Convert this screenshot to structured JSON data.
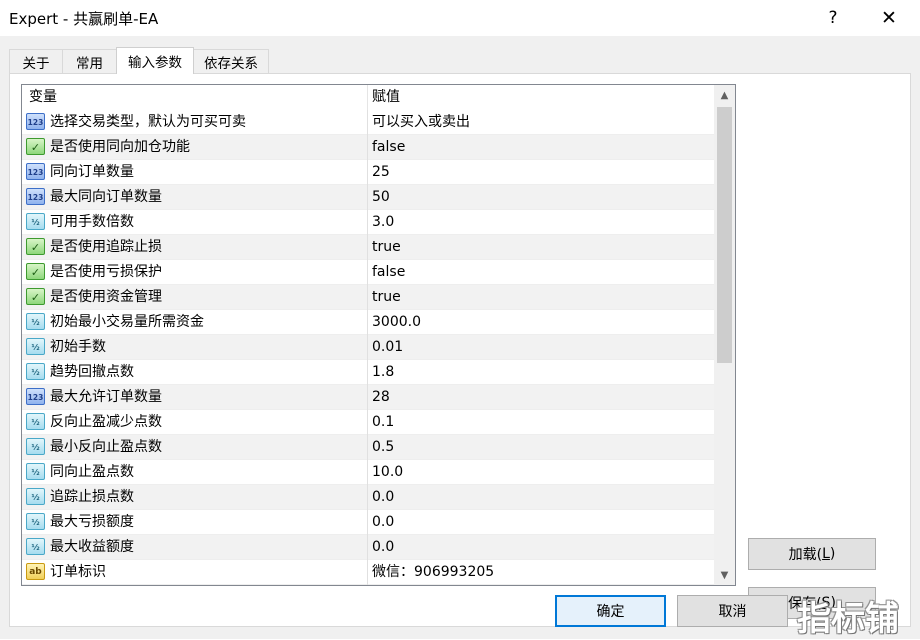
{
  "window": {
    "title": "Expert - 共赢刷单-EA",
    "help_label": "?",
    "close_label": "✕"
  },
  "tabs": [
    {
      "label": "关于"
    },
    {
      "label": "常用"
    },
    {
      "label": "输入参数",
      "active": true
    },
    {
      "label": "依存关系"
    }
  ],
  "grid": {
    "col_variable": "变量",
    "col_value": "赋值",
    "rows": [
      {
        "type": "int",
        "icon": "int-type-icon",
        "icon_text": "123",
        "name": "选择交易类型，默认为可买可卖",
        "value": "可以买入或卖出"
      },
      {
        "type": "bool",
        "icon": "bool-type-icon",
        "icon_text": "✓",
        "name": "是否使用同向加仓功能",
        "value": "false"
      },
      {
        "type": "int",
        "icon": "int-type-icon",
        "icon_text": "123",
        "name": "同向订单数量",
        "value": "25"
      },
      {
        "type": "int",
        "icon": "int-type-icon",
        "icon_text": "123",
        "name": "最大同向订单数量",
        "value": "50"
      },
      {
        "type": "dbl",
        "icon": "double-type-icon",
        "icon_text": "½",
        "name": "可用手数倍数",
        "value": "3.0"
      },
      {
        "type": "bool",
        "icon": "bool-type-icon",
        "icon_text": "✓",
        "name": "是否使用追踪止损",
        "value": "true"
      },
      {
        "type": "bool",
        "icon": "bool-type-icon",
        "icon_text": "✓",
        "name": "是否使用亏损保护",
        "value": "false"
      },
      {
        "type": "bool",
        "icon": "bool-type-icon",
        "icon_text": "✓",
        "name": "是否使用资金管理",
        "value": "true"
      },
      {
        "type": "dbl",
        "icon": "double-type-icon",
        "icon_text": "½",
        "name": "初始最小交易量所需资金",
        "value": "3000.0"
      },
      {
        "type": "dbl",
        "icon": "double-type-icon",
        "icon_text": "½",
        "name": "初始手数",
        "value": "0.01"
      },
      {
        "type": "dbl",
        "icon": "double-type-icon",
        "icon_text": "½",
        "name": "趋势回撤点数",
        "value": "1.8"
      },
      {
        "type": "int",
        "icon": "int-type-icon",
        "icon_text": "123",
        "name": "最大允许订单数量",
        "value": "28"
      },
      {
        "type": "dbl",
        "icon": "double-type-icon",
        "icon_text": "½",
        "name": "反向止盈减少点数",
        "value": "0.1"
      },
      {
        "type": "dbl",
        "icon": "double-type-icon",
        "icon_text": "½",
        "name": "最小反向止盈点数",
        "value": "0.5"
      },
      {
        "type": "dbl",
        "icon": "double-type-icon",
        "icon_text": "½",
        "name": "同向止盈点数",
        "value": "10.0"
      },
      {
        "type": "dbl",
        "icon": "double-type-icon",
        "icon_text": "½",
        "name": "追踪止损点数",
        "value": "0.0"
      },
      {
        "type": "dbl",
        "icon": "double-type-icon",
        "icon_text": "½",
        "name": "最大亏损额度",
        "value": "0.0"
      },
      {
        "type": "dbl",
        "icon": "double-type-icon",
        "icon_text": "½",
        "name": "最大收益额度",
        "value": "0.0"
      },
      {
        "type": "str",
        "icon": "string-type-icon",
        "icon_text": "ab",
        "name": "订单标识",
        "value": "微信：906993205"
      }
    ],
    "scroll_up": "▲",
    "scroll_down": "▼"
  },
  "buttons": {
    "load": {
      "text": "加载(",
      "key": "L",
      "close": ")"
    },
    "save": {
      "text": "保存(",
      "key": "S",
      "close": ")"
    },
    "ok": "确定",
    "cancel": "取消"
  },
  "watermark": "指标铺"
}
